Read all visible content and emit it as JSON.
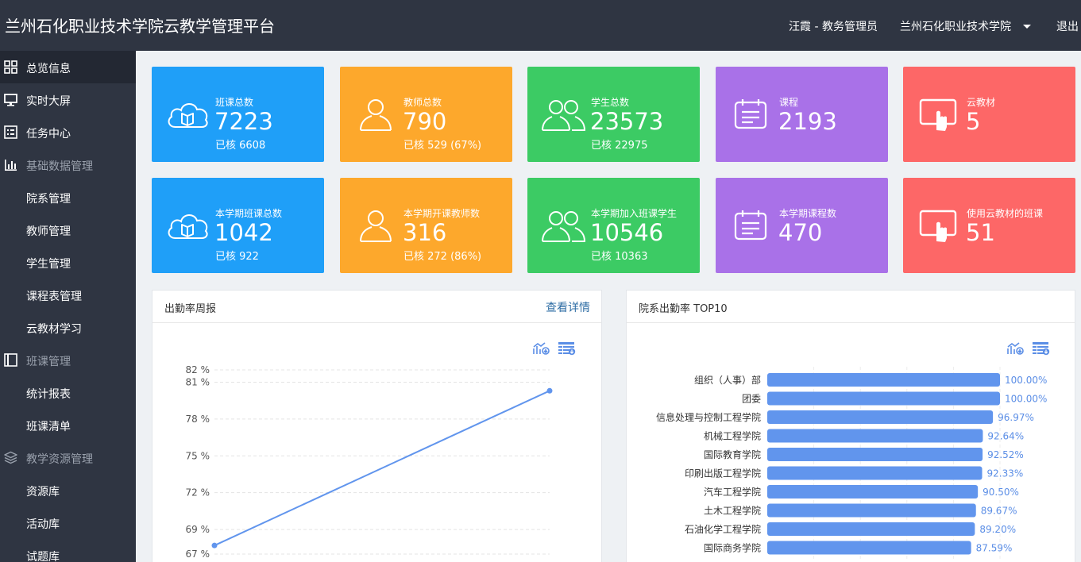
{
  "header": {
    "title": "兰州石化职业技术学院云教学管理平台",
    "user": "汪霞 - 教务管理员",
    "org": "兰州石化职业技术学院",
    "logout": "退出"
  },
  "sidebar": {
    "items": [
      {
        "label": "总览信息",
        "icon": "grid-icon"
      },
      {
        "label": "实时大屏",
        "icon": "monitor-icon"
      },
      {
        "label": "任务中心",
        "icon": "task-list-icon"
      },
      {
        "label": "基础数据管理",
        "icon": "bar-chart-icon"
      },
      {
        "label": "院系管理"
      },
      {
        "label": "教师管理"
      },
      {
        "label": "学生管理"
      },
      {
        "label": "课程表管理"
      },
      {
        "label": "云教材学习"
      },
      {
        "label": "班课管理",
        "icon": "book-icon"
      },
      {
        "label": "统计报表"
      },
      {
        "label": "班课清单"
      },
      {
        "label": "教学资源管理",
        "icon": "layers-icon"
      },
      {
        "label": "资源库"
      },
      {
        "label": "活动库"
      },
      {
        "label": "试题库"
      }
    ]
  },
  "cards_row1": [
    {
      "title": "班课总数",
      "value": "7223",
      "sub": "已核 6608",
      "icon": "cloud-book-icon",
      "color": "#1f9ff8"
    },
    {
      "title": "教师总数",
      "value": "790",
      "sub": "已核 529 (67%)",
      "icon": "person-icon",
      "color": "#fda82c"
    },
    {
      "title": "学生总数",
      "value": "23573",
      "sub": "已核 22975",
      "icon": "people-icon",
      "color": "#3ccb64"
    },
    {
      "title": "课程",
      "value": "2193",
      "sub": "",
      "icon": "calendar-icon",
      "color": "#a971e8"
    },
    {
      "title": "云教材",
      "value": "5",
      "sub": "",
      "icon": "tablet-touch-icon",
      "color": "#fd6767"
    }
  ],
  "cards_row2": [
    {
      "title": "本学期班课总数",
      "value": "1042",
      "sub": "已核 922",
      "icon": "cloud-book-icon",
      "color": "#1f9ff8"
    },
    {
      "title": "本学期开课教师数",
      "value": "316",
      "sub": "已核 272 (86%)",
      "icon": "person-icon",
      "color": "#fda82c"
    },
    {
      "title": "本学期加入班课学生",
      "value": "10546",
      "sub": "已核 10363",
      "icon": "people-icon",
      "color": "#3ccb64"
    },
    {
      "title": "本学期课程数",
      "value": "470",
      "sub": "",
      "icon": "calendar-icon",
      "color": "#a971e8"
    },
    {
      "title": "使用云教材的班课",
      "value": "51",
      "sub": "",
      "icon": "tablet-touch-icon",
      "color": "#fd6767"
    }
  ],
  "attendance_panel": {
    "title": "出勤率周报",
    "link": "查看详情"
  },
  "top10_panel": {
    "title": "院系出勤率 TOP10"
  },
  "chart_data": [
    {
      "type": "line",
      "title": "出勤率周报",
      "ytick_labels": [
        "82 %",
        "81 %",
        "78 %",
        "75 %",
        "72 %",
        "69 %",
        "67 %"
      ],
      "yticks": [
        82,
        81,
        78,
        75,
        72,
        69,
        67
      ],
      "ylim": [
        67,
        82
      ],
      "series": [
        {
          "values": [
            67.7,
            80.3
          ]
        }
      ],
      "color": "#6195ed",
      "grid": true
    },
    {
      "type": "bar",
      "orientation": "horizontal",
      "title": "院系出勤率 TOP10",
      "categories": [
        "组织（人事）部",
        "团委",
        "信息处理与控制工程学院",
        "机械工程学院",
        "国际教育学院",
        "印刷出版工程学院",
        "汽车工程学院",
        "土木工程学院",
        "石油化学工程学院",
        "国际商务学院"
      ],
      "values": [
        100.0,
        100.0,
        96.97,
        92.64,
        92.52,
        92.33,
        90.5,
        89.67,
        89.2,
        87.59
      ],
      "labels": [
        "100.00%",
        "100.00%",
        "96.97%",
        "92.64%",
        "92.52%",
        "92.33%",
        "90.50%",
        "89.67%",
        "89.20%",
        "87.59%"
      ],
      "xlim": [
        0,
        100
      ],
      "color": "#6195ed",
      "label_color": "#5b8ee6"
    }
  ]
}
